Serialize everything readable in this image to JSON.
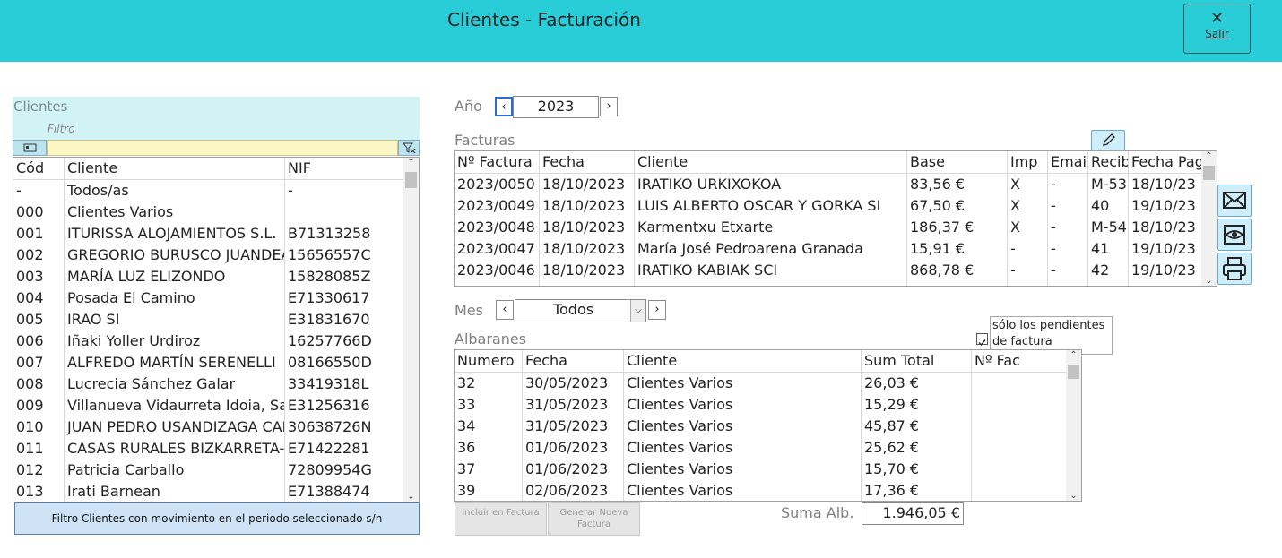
{
  "header": {
    "title": "Clientes - Facturación",
    "exit_label": "Salir",
    "exit_icon": "close-icon"
  },
  "clients": {
    "title": "Clientes",
    "filter_label": "Filtro",
    "filter_value": "",
    "columns": [
      "Cód",
      "Cliente",
      "NIF"
    ],
    "rows": [
      [
        "-",
        "Todos/as",
        "-"
      ],
      [
        "000",
        "Clientes Varios",
        ""
      ],
      [
        "001",
        "ITURISSA ALOJAMIENTOS S.L.",
        "B71313258"
      ],
      [
        "002",
        "GREGORIO BURUSCO JUANDEA",
        "15656557C"
      ],
      [
        "003",
        "MARÍA LUZ ELIZONDO",
        "15828085Z"
      ],
      [
        "004",
        "Posada El Camino",
        "E71330617"
      ],
      [
        "005",
        "IRAO SI",
        "E31831670"
      ],
      [
        "006",
        "Iñaki Yoller Urdiroz",
        "16257766D"
      ],
      [
        "007",
        "ALFREDO MARTÍN SERENELLI",
        "08166550D"
      ],
      [
        "008",
        "Lucrecia Sánchez Galar",
        "33419318L"
      ],
      [
        "009",
        "Villanueva Vidaurreta Idoia, Sar",
        "E31256316"
      ],
      [
        "010",
        "JUAN PEDRO USANDIZAGA CAN",
        "30638726N"
      ],
      [
        "011",
        "CASAS RURALES BIZKARRETA-G",
        "E71422281"
      ],
      [
        "012",
        "Patricia Carballo",
        "72809954G"
      ],
      [
        "013",
        "Irati Barnean",
        "E71388474"
      ]
    ],
    "filter_button_label": "Filtro Clientes con movimiento en el periodo seleccionado s/n"
  },
  "year": {
    "label": "Año",
    "value": "2023",
    "prev": "‹",
    "next": "›"
  },
  "invoices": {
    "title": "Facturas",
    "columns": [
      "Nº Factura",
      "Fecha",
      "Cliente",
      "Base",
      "Imp",
      "Email",
      "Recib",
      "Fecha Pag"
    ],
    "rows": [
      [
        "2023/0050",
        "18/10/2023",
        "IRATIKO URKIXOKOA",
        "83,56 €",
        "X",
        "-",
        "M-53",
        "18/10/23"
      ],
      [
        "2023/0049",
        "18/10/2023",
        "LUIS ALBERTO OSCAR Y GORKA SI",
        "67,50 €",
        "X",
        "-",
        "40",
        "19/10/23"
      ],
      [
        "2023/0048",
        "18/10/2023",
        "Karmentxu Etxarte",
        "186,37 €",
        "X",
        "-",
        "M-54",
        "18/10/23"
      ],
      [
        "2023/0047",
        "18/10/2023",
        "María José Pedroarena Granada",
        "15,91 €",
        "-",
        "-",
        "41",
        "19/10/23"
      ],
      [
        "2023/0046",
        "18/10/2023",
        "IRATIKO KABIAK SCI",
        "868,78 €",
        "-",
        "-",
        "42",
        "19/10/23"
      ]
    ]
  },
  "month": {
    "label": "Mes",
    "value": "Todos",
    "prev": "‹",
    "next": "›"
  },
  "pending_only": {
    "label": "sólo los pendientes de factura",
    "checked": true
  },
  "delivery_notes": {
    "title": "Albaranes",
    "columns": [
      "Numero",
      "Fecha",
      "Cliente",
      "Sum Total",
      "Nº Fac"
    ],
    "rows": [
      [
        "32",
        "30/05/2023",
        "Clientes Varios",
        "26,03 €",
        ""
      ],
      [
        "33",
        "31/05/2023",
        "Clientes Varios",
        "15,29 €",
        ""
      ],
      [
        "34",
        "31/05/2023",
        "Clientes Varios",
        "45,87 €",
        ""
      ],
      [
        "36",
        "01/06/2023",
        "Clientes Varios",
        "25,62 €",
        ""
      ],
      [
        "37",
        "01/06/2023",
        "Clientes Varios",
        "15,70 €",
        ""
      ],
      [
        "39",
        "02/06/2023",
        "Clientes Varios",
        "17,36 €",
        ""
      ]
    ]
  },
  "buttons": {
    "include": "Incluir en Factura",
    "generate": "Generar Nueva Factura"
  },
  "sum": {
    "label": "Suma Alb.",
    "value": "1.946,05 €"
  }
}
